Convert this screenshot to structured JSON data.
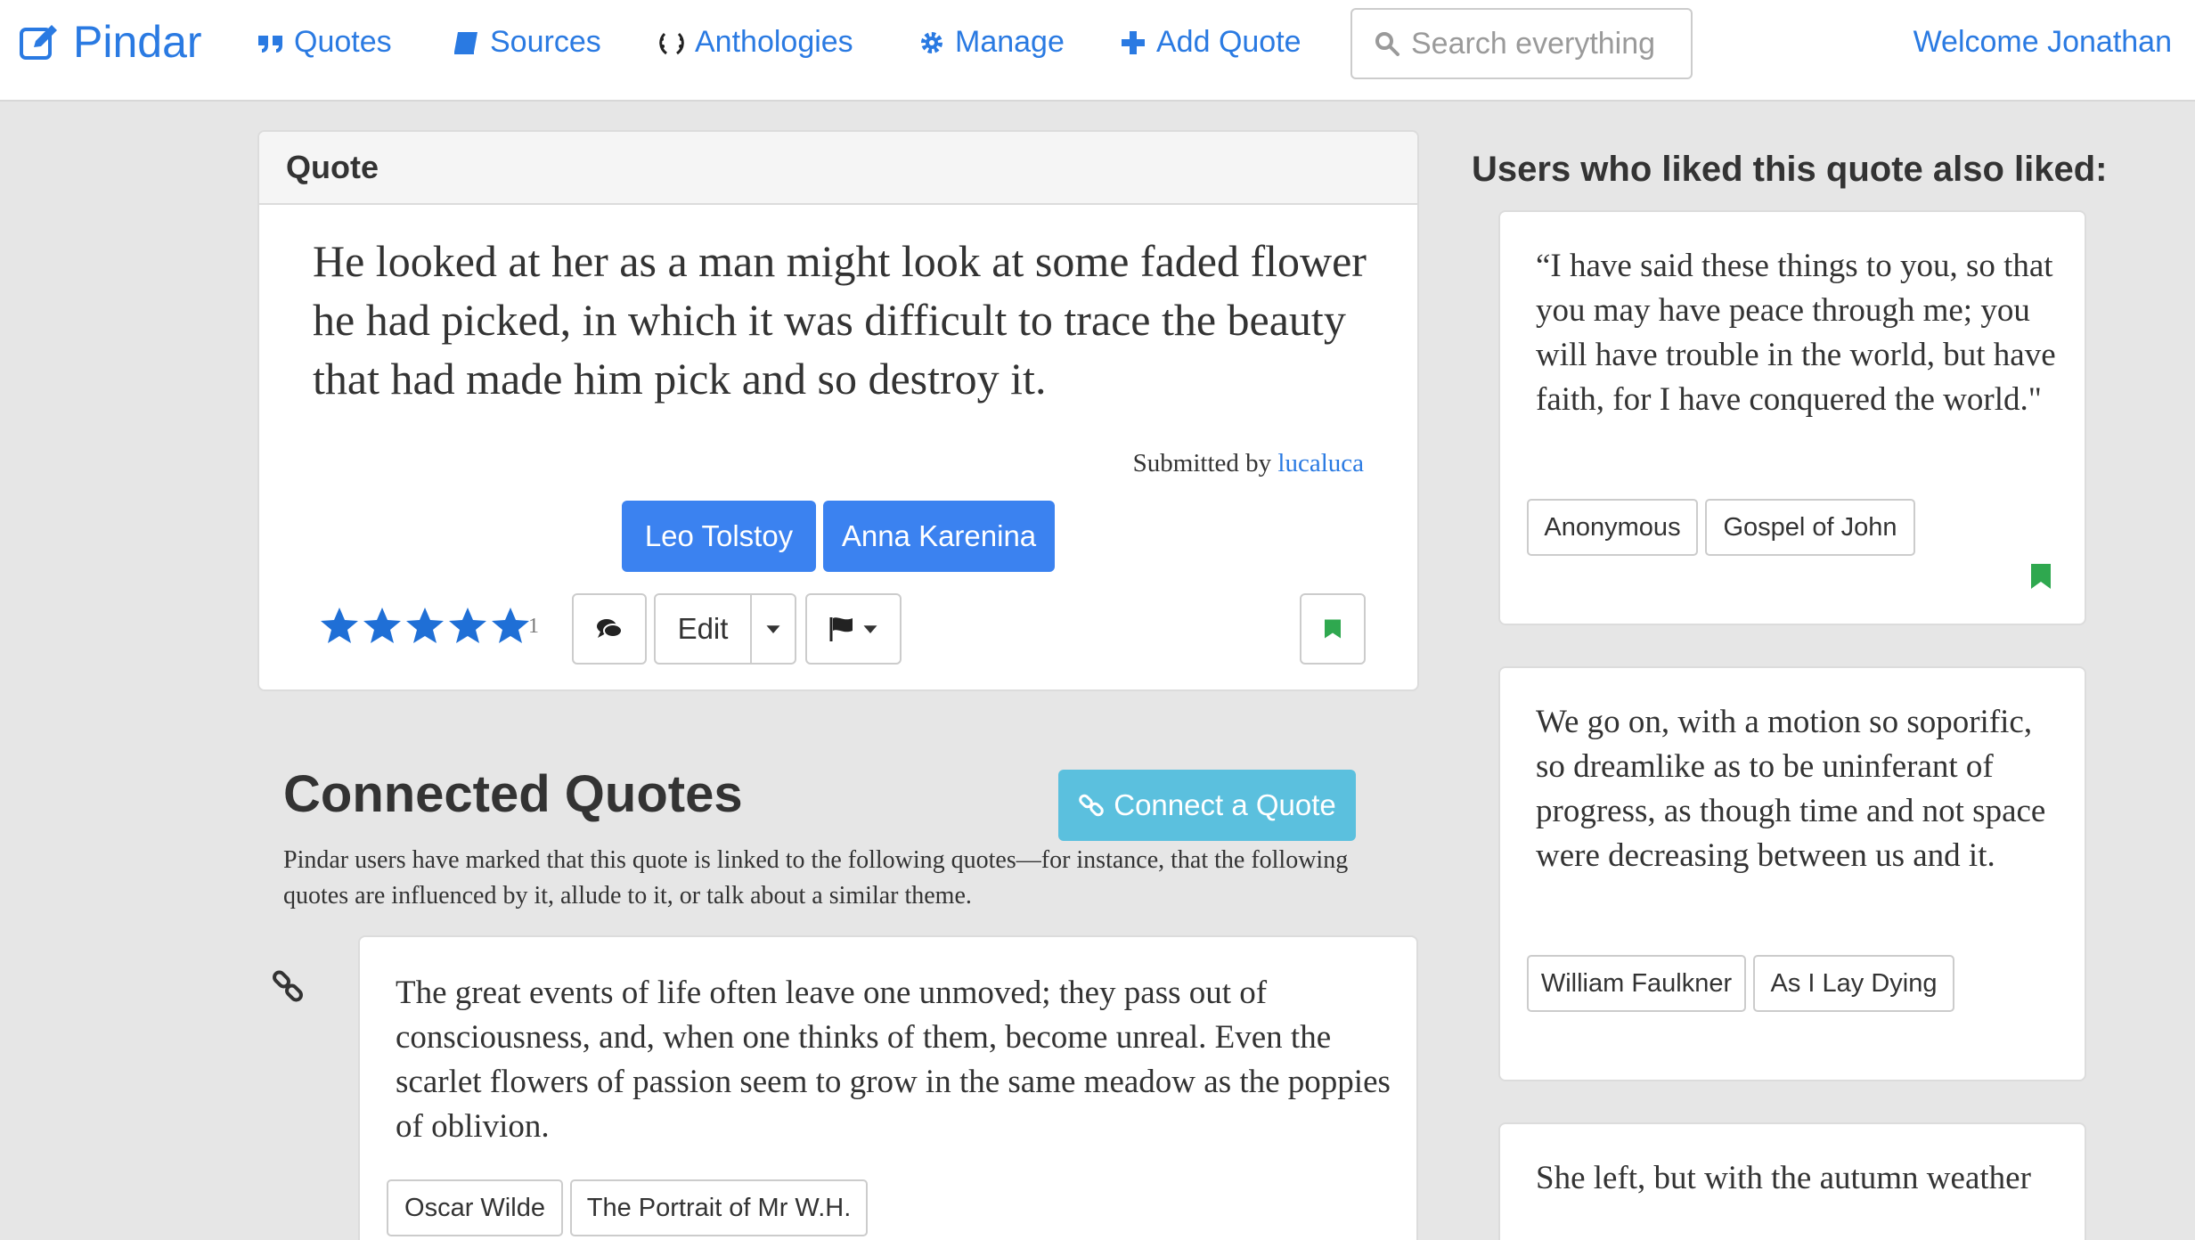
{
  "navbar": {
    "brand": "Pindar",
    "items": [
      {
        "label": "Quotes",
        "icon": "quote-icon"
      },
      {
        "label": "Sources",
        "icon": "book-icon"
      },
      {
        "label": "Anthologies",
        "icon": "laurel-icon"
      },
      {
        "label": "Manage",
        "icon": "gear-icon"
      },
      {
        "label": "Add Quote",
        "icon": "plus-icon"
      }
    ],
    "search_placeholder": "Search everything",
    "welcome": "Welcome Jonathan"
  },
  "quote": {
    "panel_title": "Quote",
    "text": "He looked at her as a man might look at some faded flower he had picked, in which it was difficult to trace the beauty that had made him pick and so destroy it.",
    "submitted_prefix": "Submitted by",
    "submitted_user": "lucaluca",
    "author": "Leo Tolstoy",
    "source": "Anna Karenina",
    "rating_stars": 5,
    "rating_count": "1",
    "edit_label": "Edit"
  },
  "connected": {
    "title": "Connected Quotes",
    "connect_button": "Connect a Quote",
    "description": "Pindar users have marked that this quote is linked to the following quotes—for instance, that the following quotes are influenced by it, allude to it, or talk about a similar theme.",
    "items": [
      {
        "text": "The great events of life often leave one unmoved; they pass out of consciousness, and, when one thinks of them, become unreal. Even the scarlet flowers of passion seem to grow in the same meadow as the poppies of oblivion.",
        "author": "Oscar Wilde",
        "source": "The Portrait of Mr W.H."
      }
    ]
  },
  "sidebar": {
    "title": "Users who liked this quote also liked:",
    "cards": [
      {
        "text": "“I have said these things to you, so that you may have peace through me; you will have trouble in the world, but have faith, for I have conquered the world.\"",
        "author": "Anonymous",
        "source": "Gospel of John"
      },
      {
        "text": "We go on, with a motion so soporific, so dreamlike as to be uninferant of progress, as though time and not space were decreasing between us and it.",
        "author": "William Faulkner",
        "source": "As I Lay Dying"
      },
      {
        "text": "She left, but with the autumn weather"
      }
    ]
  },
  "colors": {
    "link": "#2a7ae2",
    "primary_tag": "#3b82f0",
    "info_button": "#5bc0de",
    "bookmark": "#2fa84f",
    "background": "#e6e6e6"
  }
}
